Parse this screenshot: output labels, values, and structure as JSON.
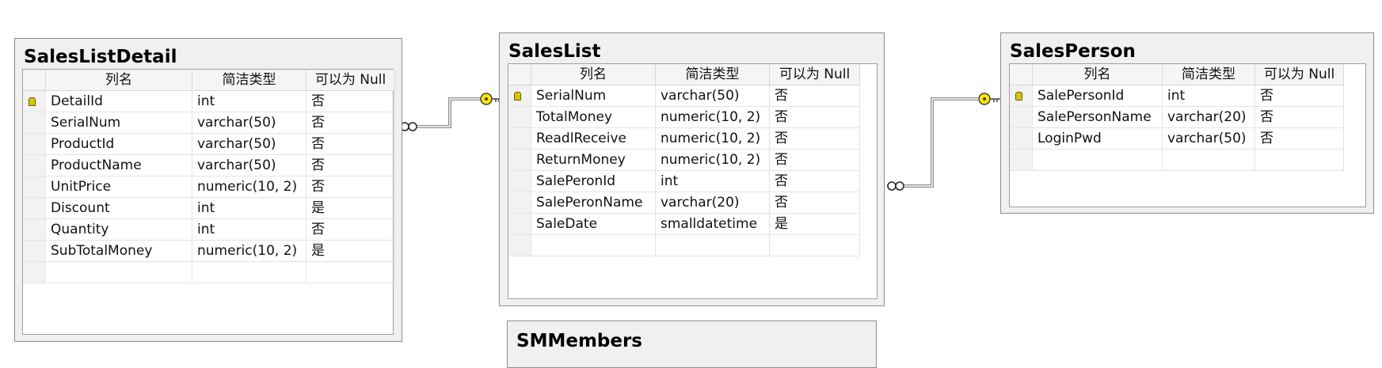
{
  "tables": [
    {
      "title": "SalesListDetail",
      "headers": [
        "列名",
        "简洁类型",
        "可以为 Null"
      ],
      "rows": [
        {
          "name": "DetailId",
          "type": "int",
          "nullable": "否",
          "key": true
        },
        {
          "name": "SerialNum",
          "type": "varchar(50)",
          "nullable": "否"
        },
        {
          "name": "ProductId",
          "type": "varchar(50)",
          "nullable": "否"
        },
        {
          "name": "ProductName",
          "type": "varchar(50)",
          "nullable": "否"
        },
        {
          "name": "UnitPrice",
          "type": "numeric(10, 2)",
          "nullable": "否"
        },
        {
          "name": "Discount",
          "type": "int",
          "nullable": "是"
        },
        {
          "name": "Quantity",
          "type": "int",
          "nullable": "否"
        },
        {
          "name": "SubTotalMoney",
          "type": "numeric(10, 2)",
          "nullable": "是"
        }
      ]
    },
    {
      "title": "SalesList",
      "headers": [
        "列名",
        "简洁类型",
        "可以为 Null"
      ],
      "rows": [
        {
          "name": "SerialNum",
          "type": "varchar(50)",
          "nullable": "否",
          "key": true
        },
        {
          "name": "TotalMoney",
          "type": "numeric(10, 2)",
          "nullable": "否"
        },
        {
          "name": "ReadlReceive",
          "type": "numeric(10, 2)",
          "nullable": "否"
        },
        {
          "name": "ReturnMoney",
          "type": "numeric(10, 2)",
          "nullable": "否"
        },
        {
          "name": "SalePeronId",
          "type": "int",
          "nullable": "否"
        },
        {
          "name": "SalePeronName",
          "type": "varchar(20)",
          "nullable": "否"
        },
        {
          "name": "SaleDate",
          "type": "smalldatetime",
          "nullable": "是"
        }
      ]
    },
    {
      "title": "SalesPerson",
      "headers": [
        "列名",
        "简洁类型",
        "可以为 Null"
      ],
      "rows": [
        {
          "name": "SalePersonId",
          "type": "int",
          "nullable": "否",
          "key": true
        },
        {
          "name": "SalePersonName",
          "type": "varchar(20)",
          "nullable": "否"
        },
        {
          "name": "LoginPwd",
          "type": "varchar(50)",
          "nullable": "否"
        }
      ]
    },
    {
      "title": "SMMembers",
      "headers": [],
      "rows": []
    }
  ],
  "relationships": [
    {
      "from": "SalesListDetail",
      "to": "SalesList"
    },
    {
      "from": "SalesList",
      "to": "SalesPerson"
    }
  ]
}
